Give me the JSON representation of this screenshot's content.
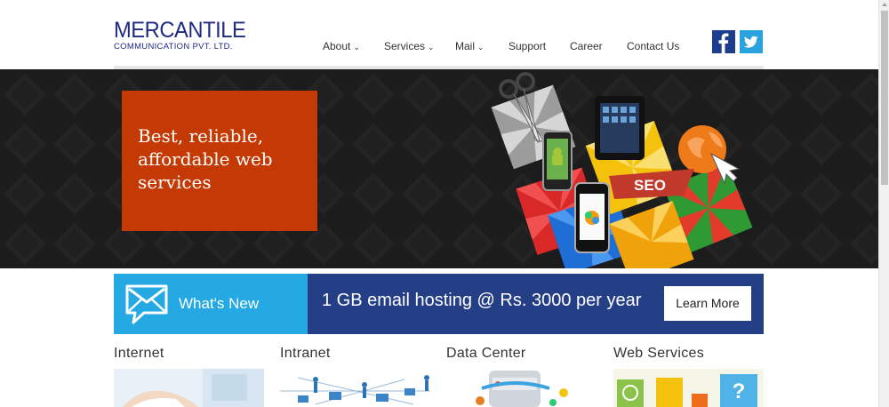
{
  "header": {
    "logo_main": "MERCANTILE",
    "logo_sub": "COMMUNICATION PVT. LTD.",
    "nav": [
      {
        "label": "About",
        "dropdown": true
      },
      {
        "label": "Services",
        "dropdown": true
      },
      {
        "label": "Mail",
        "dropdown": true
      },
      {
        "label": "Support",
        "dropdown": false
      },
      {
        "label": "Career",
        "dropdown": false
      },
      {
        "label": "Contact Us",
        "dropdown": false
      }
    ],
    "social": {
      "facebook_icon": "facebook-icon",
      "twitter_icon": "twitter-icon"
    }
  },
  "hero": {
    "tagline": "Best, reliable, affordable web services",
    "badge": "SEO"
  },
  "promo": {
    "whats_new": "What's New",
    "text": "1 GB email hosting @ Rs. 3000 per year",
    "button": "Learn More"
  },
  "services": [
    {
      "title": "Internet"
    },
    {
      "title": "Intranet"
    },
    {
      "title": "Data Center"
    },
    {
      "title": "Web Services"
    }
  ],
  "colors": {
    "brand_navy": "#1f2a83",
    "hero_orange": "#c53a04",
    "whats_new_blue": "#25a9e2",
    "promo_navy": "#253f86"
  }
}
